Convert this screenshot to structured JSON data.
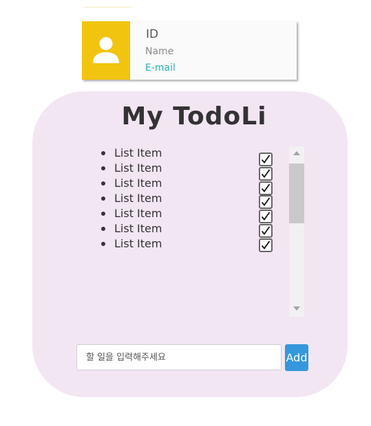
{
  "profile": {
    "id_label": "ID",
    "name_label": "Name",
    "email_label": "E-mail"
  },
  "todo": {
    "title": "My TodoLi",
    "items": [
      {
        "label": "List Item",
        "checked": true
      },
      {
        "label": "List Item",
        "checked": true
      },
      {
        "label": "List Item",
        "checked": true
      },
      {
        "label": "List Item",
        "checked": true
      },
      {
        "label": "List Item",
        "checked": true
      },
      {
        "label": "List Item",
        "checked": true
      },
      {
        "label": "List Item",
        "checked": true
      }
    ],
    "input": {
      "value": "",
      "placeholder": "할 일을 입력해주세요"
    },
    "add_label": "Add"
  },
  "colors": {
    "avatar_bg": "#f1c40f",
    "panel_bg": "#f2e6f3",
    "email_text": "#2ab0b5",
    "add_button_bg": "#3498db"
  },
  "icons": {
    "avatar": "person-icon",
    "check": "checkmark-icon",
    "scroll_up": "triangle-up-icon",
    "scroll_down": "triangle-down-icon"
  }
}
